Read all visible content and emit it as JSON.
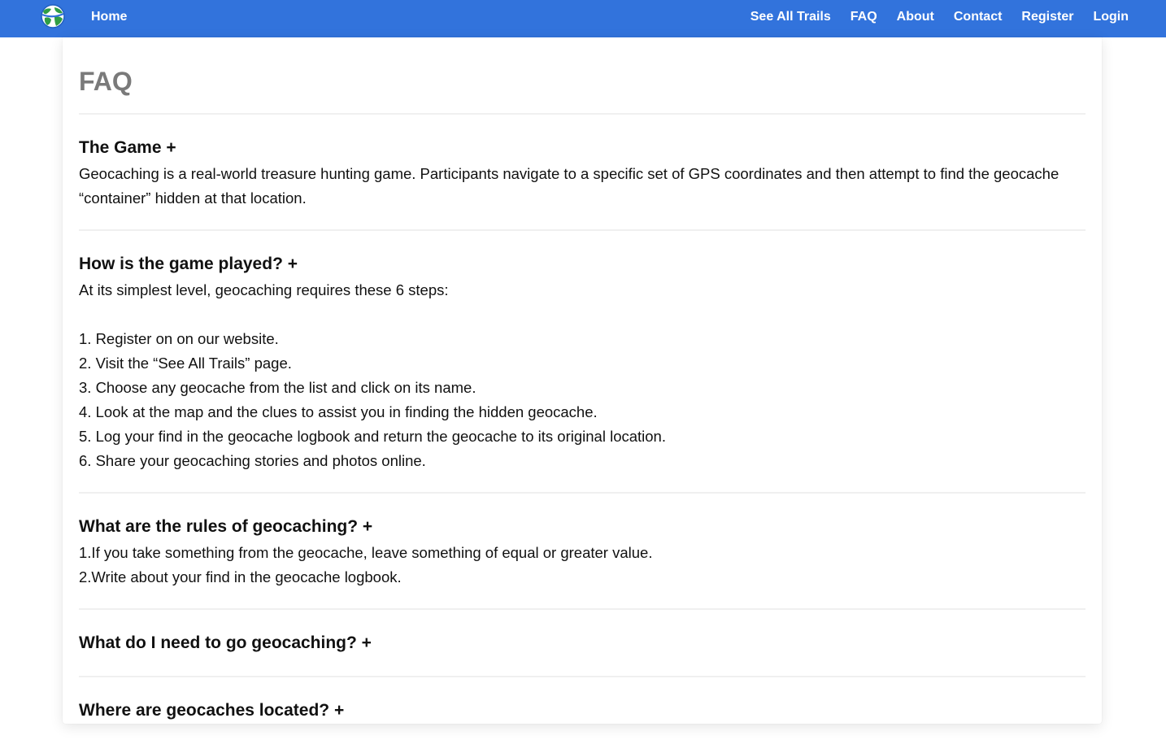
{
  "nav": {
    "logo_icon": "globe-logo-icon",
    "home": "Home",
    "links": [
      "See All Trails",
      "FAQ",
      "About",
      "Contact",
      "Register",
      "Login"
    ],
    "background_color": "#3273dc"
  },
  "page": {
    "title": "FAQ"
  },
  "faq": [
    {
      "question": "The Game +",
      "answer": [
        "Geocaching is a real-world treasure hunting game. Participants navigate to a specific set of GPS coordinates and then attempt to find the geocache “container” hidden at that location."
      ]
    },
    {
      "question": "How is the game played? +",
      "answer_intro": "At its simplest level, geocaching requires these 6 steps:",
      "steps": [
        "1. Register on on our website.",
        "2. Visit the “See All Trails” page.",
        "3. Choose any geocache from the list and click on its name.",
        "4. Look at the map and the clues to assist you in finding the hidden geocache.",
        "5. Log your find in the geocache logbook and return the geocache to its original location.",
        "6. Share your geocaching stories and photos online."
      ]
    },
    {
      "question": "What are the rules of geocaching? +",
      "rules": [
        "1.If you take something from the geocache, leave something of equal or greater value.",
        "2.Write about your find in the geocache logbook."
      ]
    },
    {
      "question": "What do I need to go geocaching? +"
    },
    {
      "question": "Where are geocaches located? +"
    }
  ]
}
